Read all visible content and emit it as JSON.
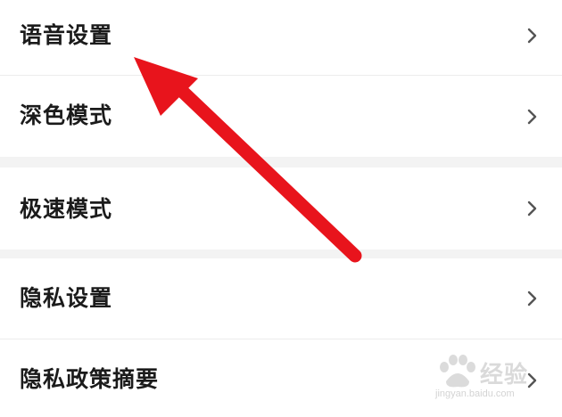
{
  "settings": {
    "items": [
      {
        "label": "语音设置"
      },
      {
        "label": "深色模式"
      },
      {
        "label": "极速模式"
      },
      {
        "label": "隐私设置"
      },
      {
        "label": "隐私政策摘要"
      }
    ]
  },
  "annotation": {
    "arrow_color": "#e8141c"
  },
  "watermark": {
    "brand": "经验",
    "url": "jingyan.baidu.com"
  },
  "colors": {
    "text": "#1b1b1b",
    "chevron": "#555555",
    "divider": "#ececec",
    "section_gap": "#f3f3f3"
  }
}
